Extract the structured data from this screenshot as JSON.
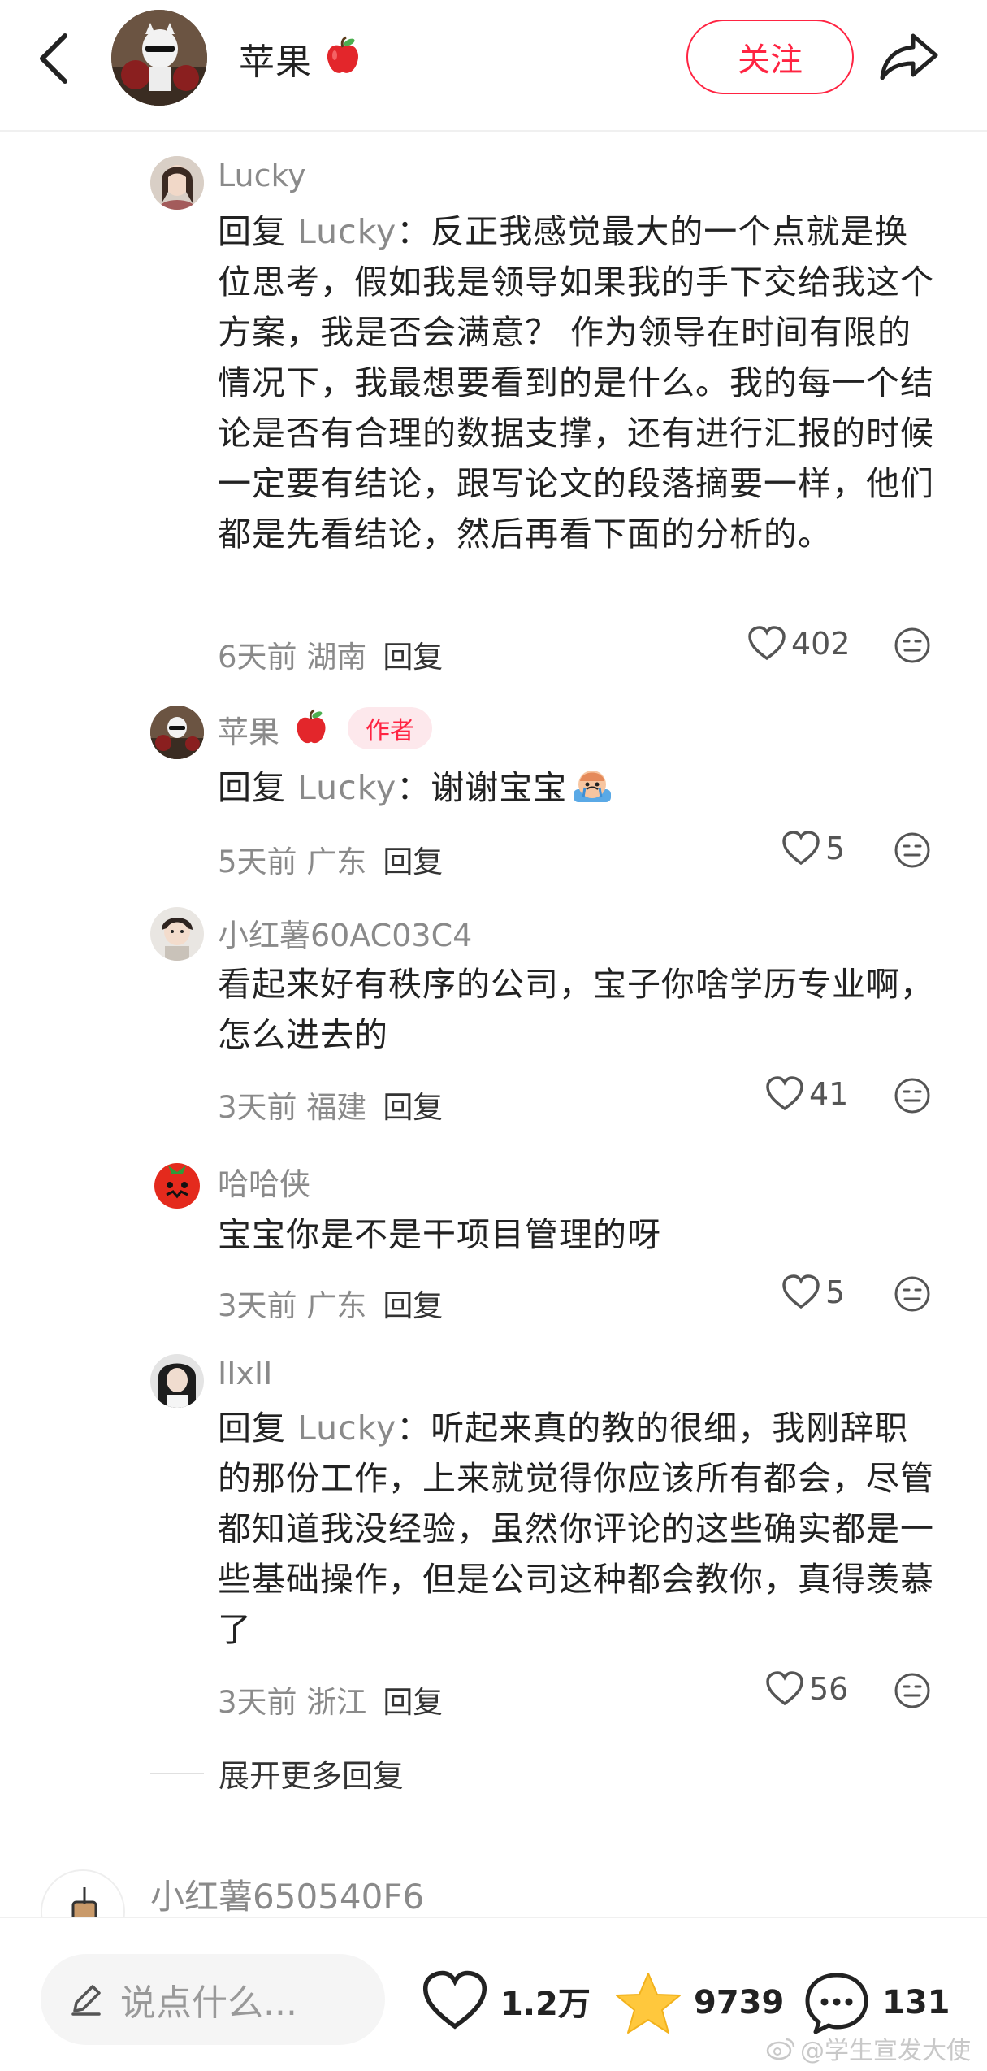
{
  "header": {
    "title": "苹果",
    "follow_label": "关注"
  },
  "replies": [
    {
      "name": "Lucky",
      "prefix": "回复",
      "mention": "Lucky",
      "sep": "：",
      "text": "反正我感觉最大的一个点就是换位思考，假如我是领导如果我的手下交给我这个方案，我是否会满意？ 作为领导在时间有限的情况下，我最想要看到的是什么。我的每一个结论是否有合理的数据支撑，还有进行汇报的时候一定要有结论，跟写论文的段落摘要一样，他们都是先看结论，然后再看下面的分析的。",
      "time": "6天前",
      "region": "湖南",
      "reply_label": "回复",
      "likes": "402"
    },
    {
      "name": "苹果",
      "tag": "作者",
      "prefix": "回复",
      "mention": "Lucky",
      "sep": "：",
      "text": "谢谢宝宝",
      "time": "5天前",
      "region": "广东",
      "reply_label": "回复",
      "likes": "5"
    },
    {
      "name": "小红薯60AC03C4",
      "text": "看起来好有秩序的公司，宝子你啥学历专业啊，怎么进去的",
      "time": "3天前",
      "region": "福建",
      "reply_label": "回复",
      "likes": "41"
    },
    {
      "name": "哈哈侠",
      "text": "宝宝你是不是干项目管理的呀",
      "time": "3天前",
      "region": "广东",
      "reply_label": "回复",
      "likes": "5"
    },
    {
      "name": "IIxII",
      "prefix": "回复",
      "mention": "Lucky",
      "sep": "：",
      "text": "听起来真的教的很细，我刚辞职的那份工作，上来就觉得你应该所有都会，尽管都知道我没经验，虽然你评论的这些确实都是一些基础操作，但是公司这种都会教你，真得羡慕了",
      "time": "3天前",
      "region": "浙江",
      "reply_label": "回复",
      "likes": "56"
    }
  ],
  "expand_label": "展开更多回复",
  "next_comment": {
    "name": "小红薯650540F6"
  },
  "bottom": {
    "input_placeholder": "说点什么...",
    "likes": "1.2万",
    "stars": "9739",
    "comments": "131",
    "watermark": "@学生宣发大使"
  },
  "colors": {
    "accent": "#ff2442",
    "star": "#ffc83d",
    "meta": "#8a8a8a"
  },
  "icons": [
    "back-arrow-icon",
    "apple-emoji-icon",
    "share-icon",
    "heart-icon",
    "face-emoji-icon",
    "pencil-icon",
    "star-icon",
    "chat-bubble-icon"
  ]
}
